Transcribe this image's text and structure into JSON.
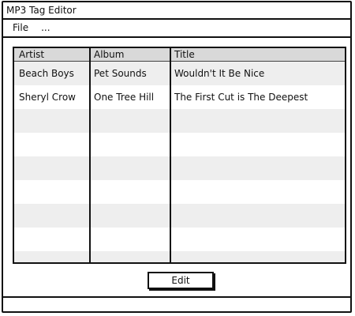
{
  "window": {
    "title": "MP3 Tag Editor"
  },
  "menubar": {
    "items": [
      "File",
      "..."
    ]
  },
  "table": {
    "columns": [
      "Artist",
      "Album",
      "Title"
    ],
    "rows": [
      {
        "artist": "Beach Boys",
        "album": "Pet Sounds",
        "title": "Wouldn't It Be Nice"
      },
      {
        "artist": "Sheryl Crow",
        "album": "One Tree Hill",
        "title": "The First Cut is The Deepest"
      }
    ]
  },
  "actions": {
    "edit_label": "Edit"
  },
  "status": {
    "text": ""
  }
}
